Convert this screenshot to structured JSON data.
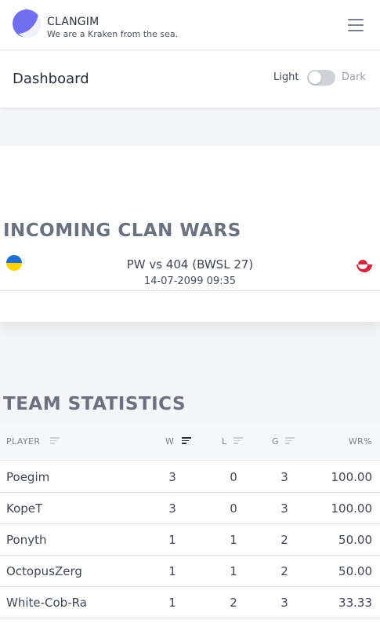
{
  "header": {
    "brand_name": "CLANGIM",
    "tagline": "We are a Kraken from the sea.",
    "logo_icon": "crescent-moon-logo",
    "menu_icon": "hamburger-menu-icon"
  },
  "page": {
    "title": "Dashboard",
    "theme_light_label": "Light",
    "theme_dark_label": "Dark",
    "dark_mode_enabled": false
  },
  "wars": {
    "title": "INCOMING CLAN WARS",
    "matches": [
      {
        "title": "PW vs 404 (BWSL 27)",
        "datetime": "14-07-2099 09:35",
        "left_flag": "ukraine-flag-icon",
        "right_flag": "greenland-flag-icon"
      }
    ]
  },
  "stats": {
    "title": "TEAM STATISTICS",
    "columns": [
      "PLAYER",
      "W",
      "L",
      "G",
      "WR%"
    ],
    "sorted_column": "W",
    "rows": [
      [
        "Poegim",
        "3",
        "0",
        "3",
        "100.00"
      ],
      [
        "KopeT",
        "3",
        "0",
        "3",
        "100.00"
      ],
      [
        "Ponyth",
        "1",
        "1",
        "2",
        "50.00"
      ],
      [
        "OctopusZerg",
        "1",
        "1",
        "2",
        "50.00"
      ],
      [
        "White-Cob-Ra",
        "1",
        "2",
        "3",
        "33.33"
      ]
    ]
  },
  "colors": {
    "accent": "#6f6ff0",
    "section_title": "#6a7180",
    "ukraine_blue": "#1f6fd1",
    "ukraine_yellow": "#ffd400",
    "greenland_red": "#d8243c"
  }
}
